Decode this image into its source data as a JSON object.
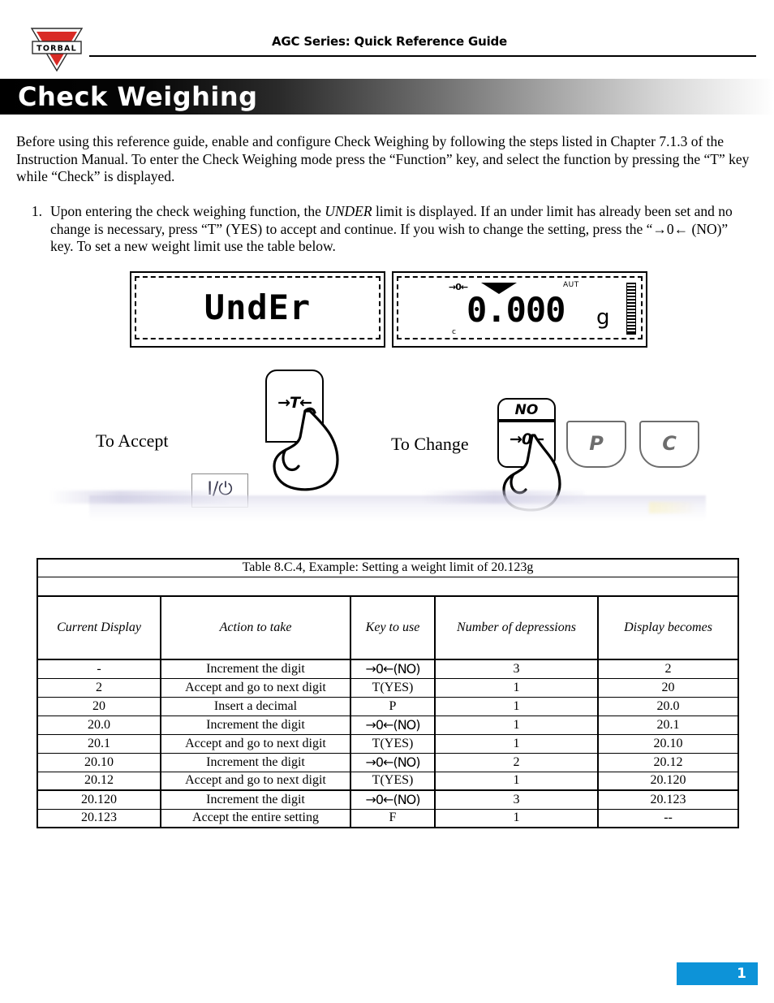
{
  "header": {
    "title": "AGC Series: Quick Reference Guide",
    "logo_text": "TORBAL",
    "logo_color": "#d92b26"
  },
  "banner": {
    "title": "Check Weighing",
    "gradient_from": "#000000",
    "gradient_to": "#ffffff"
  },
  "intro": {
    "paragraph": "Before using this reference guide, enable and configure Check Weighing by following the steps listed in Chapter 7.1.3 of the Instruction Manual. To enter the Check Weighing mode press the “Function” key, and select the function by pressing the “T” key while “Check” is displayed."
  },
  "steps": [
    {
      "number": "1.",
      "part1": "Upon entering the check weighing function, the ",
      "emphasis": "UNDER",
      "part2": " limit is displayed. If an under limit has already been set and no change is necessary, press “T” (YES) to accept and continue. If you wish to change the setting, press the “→0← (NO)” key. To set a new weight limit use the table below."
    }
  ],
  "displays": {
    "left": {
      "segment_text": "UndEr"
    },
    "right": {
      "zero_indicator": "→0←",
      "aut_indicator": "AUT",
      "c_indicator": "c",
      "value": "0.000",
      "unit": "g"
    }
  },
  "keys": {
    "accept_label": "To Accept",
    "change_label": "To Change",
    "t_key": "→T←",
    "no_key": "NO",
    "zero_key": "→0←",
    "p_key": "P",
    "c_key": "C",
    "power_key": "I/⏻"
  },
  "table": {
    "caption": "Table  8.C.4, Example: Setting a weight limit of 20.123g",
    "blank_row": "",
    "headers": [
      "Current Display",
      "Action to take",
      "Key to use",
      "Number of depressions",
      "Display becomes"
    ],
    "rows": [
      [
        "-",
        "Increment the digit",
        "→0←(NO)",
        "3",
        "2"
      ],
      [
        "2",
        "Accept and go to next digit",
        "T(YES)",
        "1",
        "20"
      ],
      [
        "20",
        "Insert a decimal",
        "P",
        "1",
        "20.0"
      ],
      [
        "20.0",
        "Increment the digit",
        "→0←(NO)",
        "1",
        "20.1"
      ],
      [
        "20.1",
        "Accept and go to next digit",
        "T(YES)",
        "1",
        "20.10"
      ],
      [
        "20.10",
        "Increment the digit",
        "→0←(NO)",
        "2",
        "20.12"
      ],
      [
        "20.12",
        "Accept and go to next digit",
        "T(YES)",
        "1",
        "20.120"
      ],
      [
        "20.120",
        "Increment the digit",
        "→0←(NO)",
        "3",
        "20.123"
      ],
      [
        "20.123",
        "Accept the entire setting",
        "F",
        "1",
        "--"
      ]
    ]
  },
  "footer": {
    "page_number": "1",
    "badge_color": "#0d93d8"
  }
}
